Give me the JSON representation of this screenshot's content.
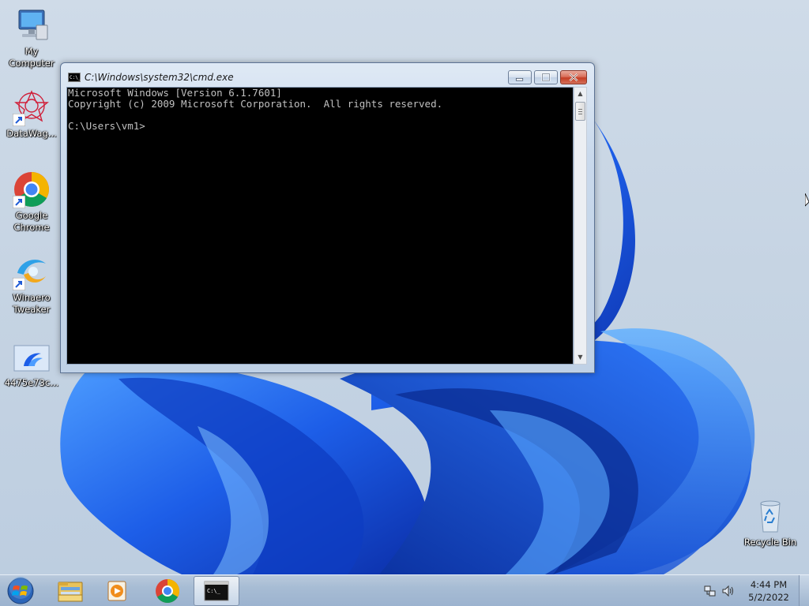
{
  "desktop": {
    "icons": [
      {
        "label": "My Computer",
        "icon": "computer-icon"
      },
      {
        "label": "DataWag...",
        "icon": "datawag-icon"
      },
      {
        "label": "Google Chrome",
        "icon": "chrome-icon"
      },
      {
        "label": "Winaero Tweaker",
        "icon": "winaero-icon"
      },
      {
        "label": "4475e73c...",
        "icon": "image-file-icon"
      },
      {
        "label": "Recycle Bin",
        "icon": "recycle-bin-icon"
      }
    ]
  },
  "cmd_window": {
    "title": "C:\\Windows\\system32\\cmd.exe",
    "console_lines": [
      "Microsoft Windows [Version 6.1.7601]",
      "Copyright (c) 2009 Microsoft Corporation.  All rights reserved.",
      "",
      "C:\\Users\\vm1>"
    ]
  },
  "taskbar": {
    "pinned": [
      {
        "name": "explorer",
        "icon": "folder-icon"
      },
      {
        "name": "media-player",
        "icon": "media-player-icon"
      },
      {
        "name": "chrome",
        "icon": "chrome-icon"
      },
      {
        "name": "cmd",
        "icon": "cmd-icon",
        "active": true
      }
    ],
    "clock": {
      "time": "4:44 PM",
      "date": "5/2/2022"
    }
  },
  "colors": {
    "accent_blue": "#1f5bd6",
    "console_bg": "#000000",
    "console_fg": "#c0c0c0",
    "close_red": "#c43d24"
  }
}
